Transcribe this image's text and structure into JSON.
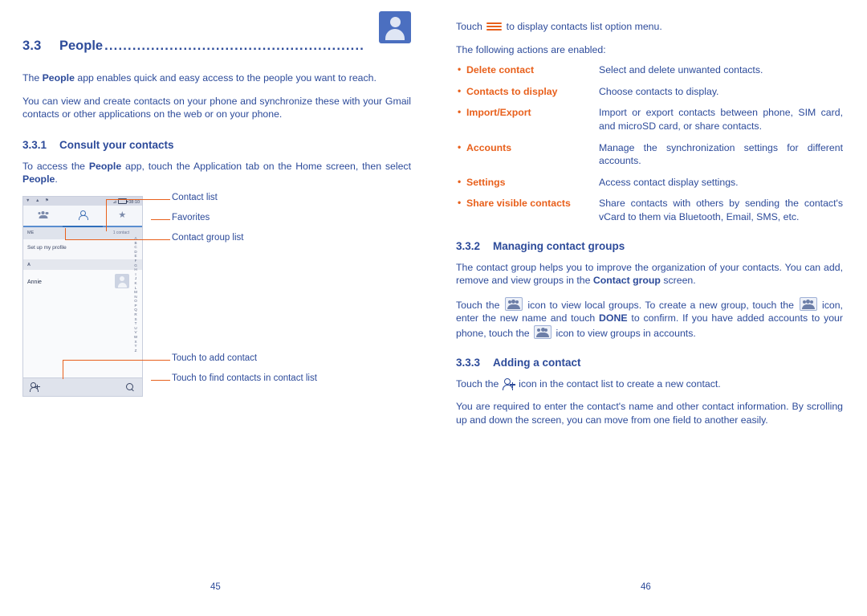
{
  "left": {
    "section": {
      "number": "3.3",
      "title": "People",
      "dots": "........................................................"
    },
    "paragraphs": {
      "p1": "The People app enables quick and easy access to the people you want to reach.",
      "p1_bold": "People",
      "p2": "You can view and create contacts on your phone and synchronize these with your Gmail contacts or other applications on the web or on your phone."
    },
    "subsection_1": {
      "number": "3.3.1",
      "title": "Consult your contacts"
    },
    "p3_parts": {
      "a": "To access the ",
      "b": "People",
      "c": " app, touch the Application tab on the Home screen, then select ",
      "d": "People",
      "e": "."
    },
    "figure": {
      "status": {
        "time": "08:10",
        "left_icons": "▼ ▲ ⚑",
        "signal": "⊿"
      },
      "me_label": "ME",
      "contact_count": "1 contact",
      "profile_row": "Set up my profile",
      "letter_a": "A",
      "contact_name": "Annie",
      "alpha_index": "ABCDEFGHIJKLMNOPQRSTUVWXYZ",
      "callouts": {
        "contact_list": "Contact list",
        "favorites": "Favorites",
        "contact_group_list": "Contact group list",
        "add_contact": "Touch to add contact",
        "find_contacts": "Touch to find contacts in contact list"
      }
    },
    "page_number": "45"
  },
  "right": {
    "intro": {
      "line1_a": "Touch ",
      "line1_b": " to display contacts list option menu.",
      "line2": "The following actions are enabled:"
    },
    "options": [
      {
        "term": "Delete contact",
        "def": "Select and delete unwanted contacts."
      },
      {
        "term": "Contacts to display",
        "def": "Choose contacts to display."
      },
      {
        "term": "Import/Export",
        "def": "Import or export contacts between phone, SIM card, and microSD card, or share contacts."
      },
      {
        "term": "Accounts",
        "def": "Manage the synchronization settings for different accounts."
      },
      {
        "term": "Settings",
        "def": "Access contact display settings."
      },
      {
        "term": "Share visible contacts",
        "def": "Share contacts with others by sending the contact's vCard to them via Bluetooth, Email, SMS, etc."
      }
    ],
    "subsection_2": {
      "number": "3.3.2",
      "title": "Managing contact groups"
    },
    "p1_parts": {
      "a": "The contact group helps you to improve the organization of your contacts. You can add, remove and view groups in the ",
      "b": "Contact group",
      "c": " screen."
    },
    "p2_parts": {
      "a": "Touch the ",
      "b": " icon to view local groups. To create a new group, touch the ",
      "c": " icon, enter the new name and touch ",
      "d": "DONE",
      "e": " to confirm. If you have added accounts to your phone, touch the ",
      "f": " icon to view groups in accounts."
    },
    "subsection_3": {
      "number": "3.3.3",
      "title": "Adding a contact"
    },
    "p3_parts": {
      "a": "Touch the ",
      "b": " icon in the contact list to create a new contact."
    },
    "p4": "You are required to enter the contact's name and other contact information. By scrolling up and down the screen, you can move from one field to another easily.",
    "page_number": "46"
  },
  "colors": {
    "blue": "#2d4b9a",
    "orange": "#e8601c"
  }
}
